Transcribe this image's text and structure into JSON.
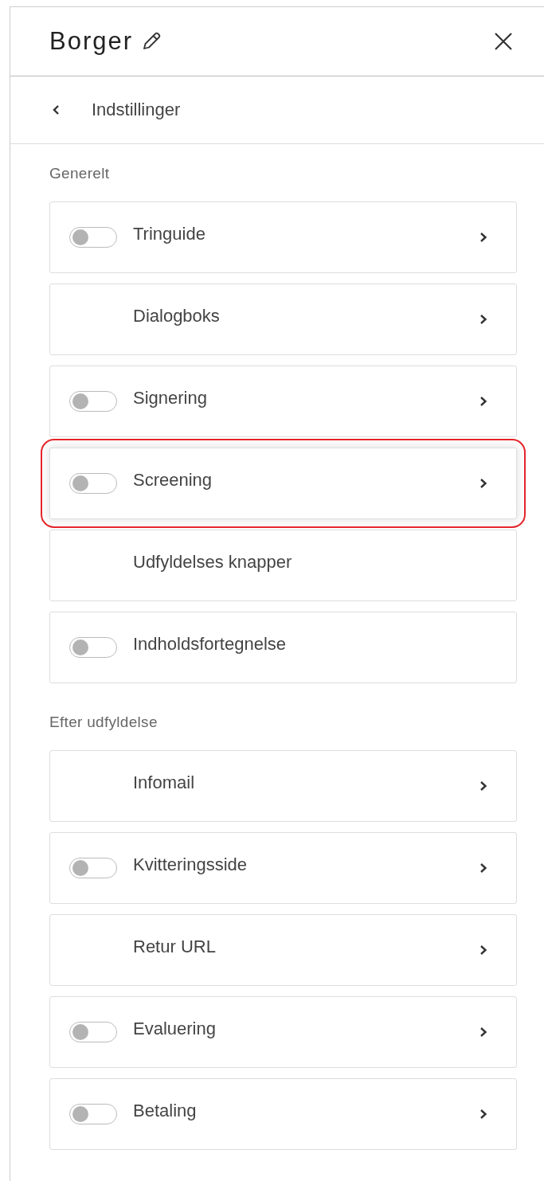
{
  "header": {
    "title": "Borger"
  },
  "back": {
    "label": "Indstillinger"
  },
  "sections": [
    {
      "title": "Generelt",
      "rows": [
        {
          "label": "Tringuide",
          "kind": "toggle",
          "on": false,
          "chevron": true,
          "highlighted": false
        },
        {
          "label": "Dialogboks",
          "kind": "plain",
          "chevron": true,
          "highlighted": false
        },
        {
          "label": "Signering",
          "kind": "toggle",
          "on": false,
          "chevron": true,
          "highlighted": false
        },
        {
          "label": "Screening",
          "kind": "toggle",
          "on": false,
          "chevron": true,
          "highlighted": true
        },
        {
          "label": "Udfyldelses knapper",
          "kind": "plain",
          "chevron": false,
          "highlighted": false
        },
        {
          "label": "Indholdsfortegnelse",
          "kind": "toggle",
          "on": false,
          "chevron": false,
          "highlighted": false
        }
      ]
    },
    {
      "title": "Efter udfyldelse",
      "rows": [
        {
          "label": "Infomail",
          "kind": "plain",
          "chevron": true,
          "highlighted": false
        },
        {
          "label": "Kvitteringsside",
          "kind": "toggle",
          "on": false,
          "chevron": true,
          "highlighted": false
        },
        {
          "label": "Retur URL",
          "kind": "plain",
          "chevron": true,
          "highlighted": false
        },
        {
          "label": "Evaluering",
          "kind": "toggle",
          "on": false,
          "chevron": true,
          "highlighted": false
        },
        {
          "label": "Betaling",
          "kind": "toggle",
          "on": false,
          "chevron": true,
          "highlighted": false
        }
      ]
    }
  ]
}
